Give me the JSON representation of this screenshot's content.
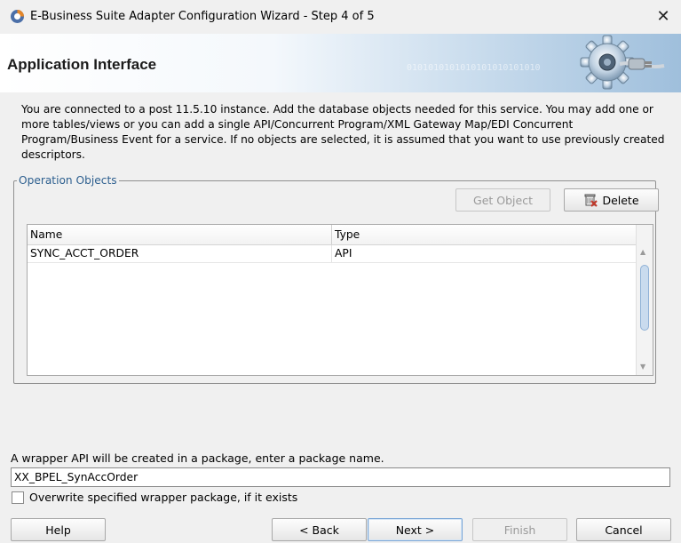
{
  "window": {
    "title": "E-Business Suite Adapter Configuration Wizard - Step 4 of 5"
  },
  "banner": {
    "title": "Application Interface",
    "binary_text": "0101010101010101010101010"
  },
  "description": "You are connected to a post 11.5.10 instance. Add the database objects needed for this service. You may add one or more tables/views or you can add a single API/Concurrent Program/XML Gateway Map/EDI Concurrent Program/Business Event for a service. If no objects are selected, it is assumed that you want to use previously created descriptors.",
  "operation_objects": {
    "legend": "Operation Objects",
    "get_object_label": "Get Object",
    "delete_label": "Delete",
    "columns": [
      "Name",
      "Type"
    ],
    "rows": [
      {
        "name": "SYNC_ACCT_ORDER",
        "type": "API"
      }
    ]
  },
  "package": {
    "label": "A wrapper API will be created in a package, enter a package name.",
    "value": "XX_BPEL_SynAccOrder",
    "overwrite_label": "Overwrite specified wrapper package, if it exists",
    "overwrite_checked": false
  },
  "footer": {
    "help": "Help",
    "back": "< Back",
    "next": "Next >",
    "finish": "Finish",
    "cancel": "Cancel"
  },
  "colors": {
    "legend": "#2d5f8f",
    "banner_end": "#9fbfdc",
    "default_button_border": "#7aa6d6"
  }
}
